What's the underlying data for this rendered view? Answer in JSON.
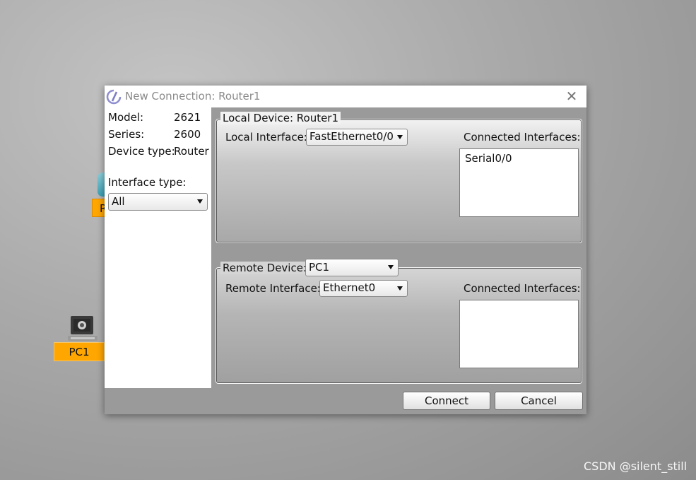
{
  "workspace": {
    "router_label": "R",
    "pc_label": "PC1"
  },
  "dialog": {
    "title": "New Connection: Router1",
    "close_glyph": "✕",
    "device_info": {
      "model_label": "Model:",
      "model_value": "2621",
      "series_label": "Series:",
      "series_value": "2600",
      "device_type_label": "Device type:",
      "device_type_value": "Router"
    },
    "interface_type": {
      "label": "Interface type:",
      "selected": "All"
    },
    "local": {
      "legend": "Local Device: Router1",
      "interface_label": "Local Interface:",
      "interface_selected": "FastEthernet0/0",
      "connected_label": "Connected Interfaces:",
      "connected_items": [
        "Serial0/0"
      ]
    },
    "remote": {
      "legend_label": "Remote Device:",
      "device_selected": "PC1",
      "interface_label": "Remote Interface:",
      "interface_selected": "Ethernet0",
      "connected_label": "Connected Interfaces:",
      "connected_items": []
    },
    "buttons": {
      "connect": "Connect",
      "cancel": "Cancel"
    }
  },
  "watermark": "CSDN @silent_still",
  "icons": {
    "title": "packet-tracer-logo-icon",
    "router": "router-icon",
    "pc": "pc-icon",
    "dropdown": "dropdown-arrow-icon"
  },
  "colors": {
    "device_label_bg": "#ffa600",
    "dialog_bg": "#9a9a9a"
  }
}
